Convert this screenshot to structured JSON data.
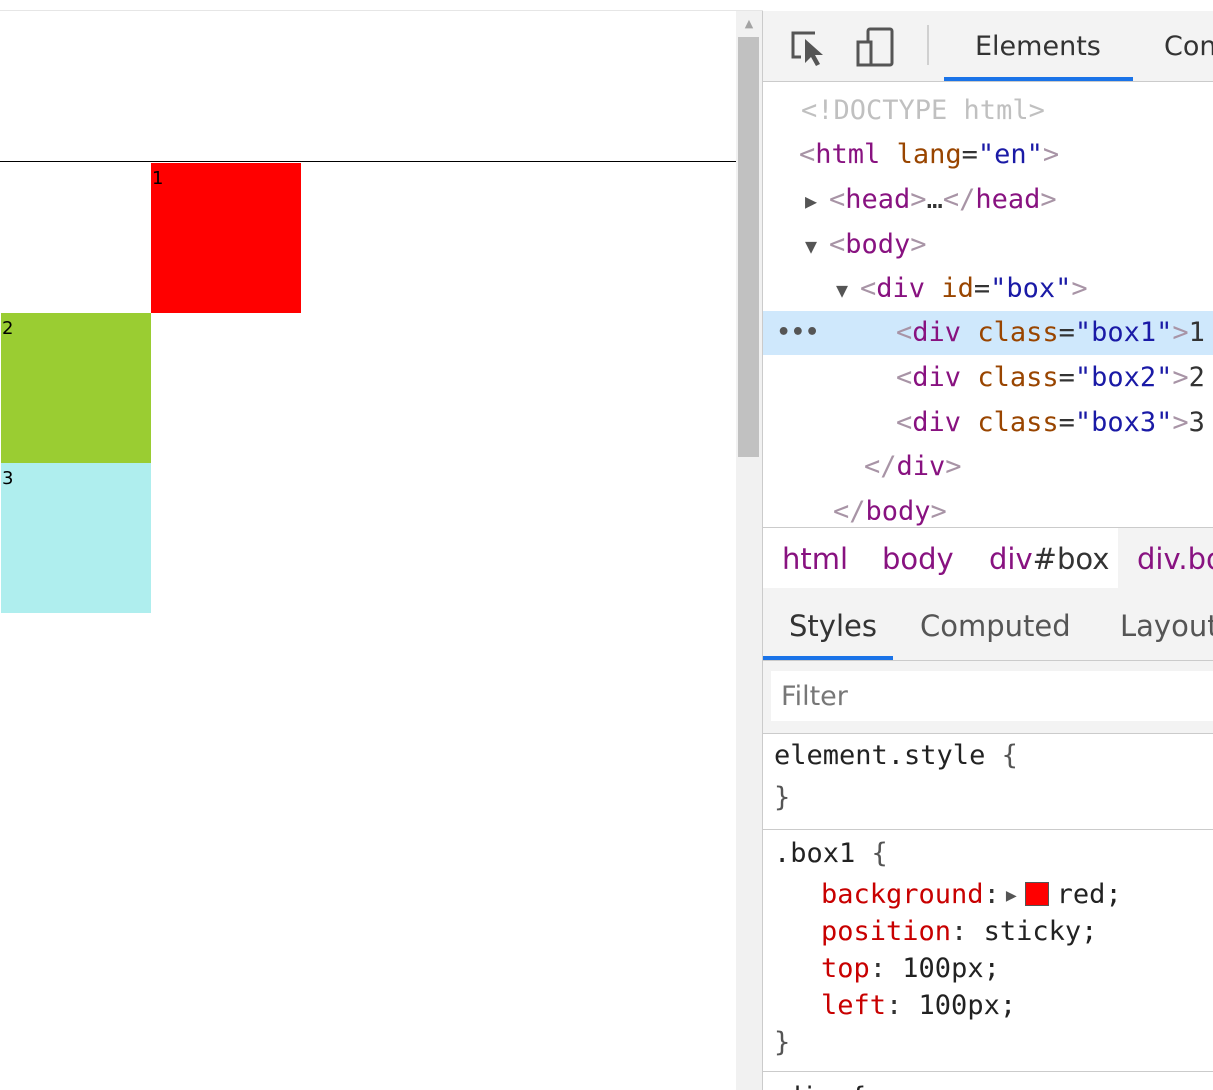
{
  "page": {
    "boxes": [
      {
        "label": "1",
        "color": "#ff0000"
      },
      {
        "label": "2",
        "color": "#9acd32"
      },
      {
        "label": "3",
        "color": "#afeeee"
      }
    ]
  },
  "devtools": {
    "tabs": {
      "elements": "Elements",
      "console": "Con"
    },
    "icons": {
      "inspect": "inspect-element-icon",
      "device": "device-toolbar-icon",
      "expand": "expand-triangle-icon",
      "collapse": "collapse-triangle-icon",
      "more": "more-dots-icon"
    },
    "dom": {
      "doctype": "<!DOCTYPE html>",
      "html_tag": "html",
      "lang_attr": "lang",
      "lang_val": "\"en\"",
      "head_tag": "head",
      "ellipsis": "…",
      "body_tag": "body",
      "div_tag": "div",
      "id_attr": "id",
      "id_val": "\"box\"",
      "class_attr": "class",
      "box1_val": "\"box1\"",
      "box2_val": "\"box2\"",
      "box3_val": "\"box3\"",
      "box1_text": "1",
      "box2_text": "2",
      "box3_text": "3",
      "dots": "•••"
    },
    "breadcrumbs": {
      "html": "html",
      "body": "body",
      "div_tag": "div",
      "div_id": "#box",
      "active": "div.bo"
    },
    "sub_tabs": {
      "styles": "Styles",
      "computed": "Computed",
      "layout": "Layout"
    },
    "filter_placeholder": "Filter",
    "styles": {
      "element_selector": "element.style",
      "box1_selector": ".box1",
      "open_brace": "{",
      "close_brace": "}",
      "props": [
        {
          "name": "background",
          "value": "red;"
        },
        {
          "name": "position",
          "value": "sticky;"
        },
        {
          "name": "top",
          "value": "100px;"
        },
        {
          "name": "left",
          "value": "100px;"
        }
      ],
      "next_selector": "div {"
    },
    "accent_color": "#1a73e8"
  }
}
